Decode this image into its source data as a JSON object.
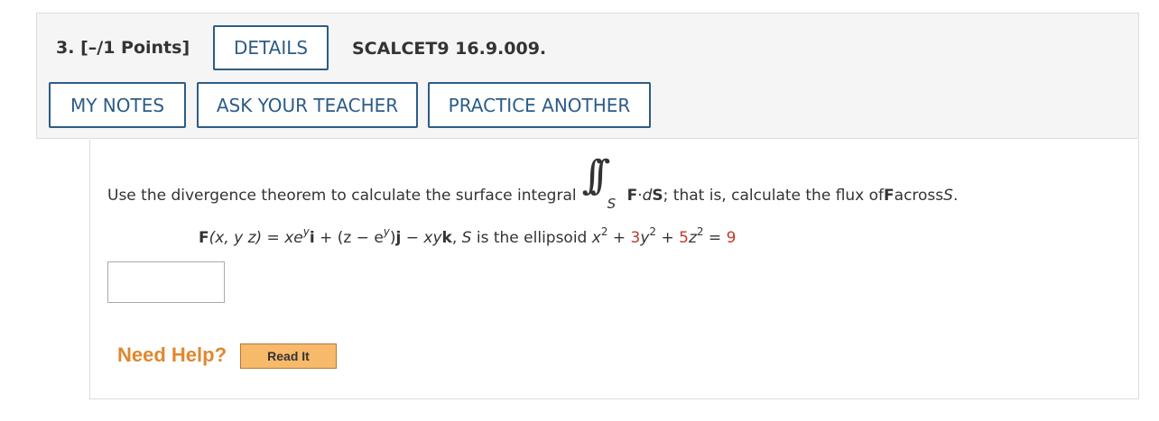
{
  "header": {
    "question_number": "3.",
    "points": "[–/1 Points]",
    "details_label": "DETAILS",
    "problem_code": "SCALCET9 16.9.009.",
    "my_notes_label": "MY NOTES",
    "ask_teacher_label": "ASK YOUR TEACHER",
    "practice_another_label": "PRACTICE ANOTHER"
  },
  "question": {
    "intro": "Use the divergence theorem to calculate the surface integral",
    "integral_subscript": "S",
    "integrand_F": "F",
    "integrand_dot": " · ",
    "integrand_d": "d",
    "integrand_S": "S",
    "tail_1": "; that is, calculate the flux of ",
    "tail_F": "F",
    "tail_2": " across ",
    "tail_S": "S",
    "tail_3": "."
  },
  "formula": {
    "F": "F",
    "args": "(x, y z) = xe",
    "sup1": "y",
    "i": "i",
    "mid1": " + (z − e",
    "sup2": "y",
    "mid2": ")",
    "j": "j",
    "mid3": " − xy",
    "k": "k",
    "comma": ",   ",
    "S": "S",
    "ellipsoid_text": " is the ellipsoid ",
    "x": "x",
    "exp_x": "2",
    "plus1": " + ",
    "coef_y": "3",
    "y": "y",
    "exp_y": "2",
    "plus2": " + ",
    "coef_z": "5",
    "z": "z",
    "exp_z": "2",
    "eq": " = ",
    "rhs": "9"
  },
  "answer": {
    "value": ""
  },
  "help": {
    "need_help_label": "Need Help?",
    "read_it_label": "Read It"
  },
  "colors": {
    "button_border": "#2c5c87",
    "given_value": "#c0392b",
    "need_help": "#e0872e",
    "read_it_bg": "#f7b96a"
  }
}
